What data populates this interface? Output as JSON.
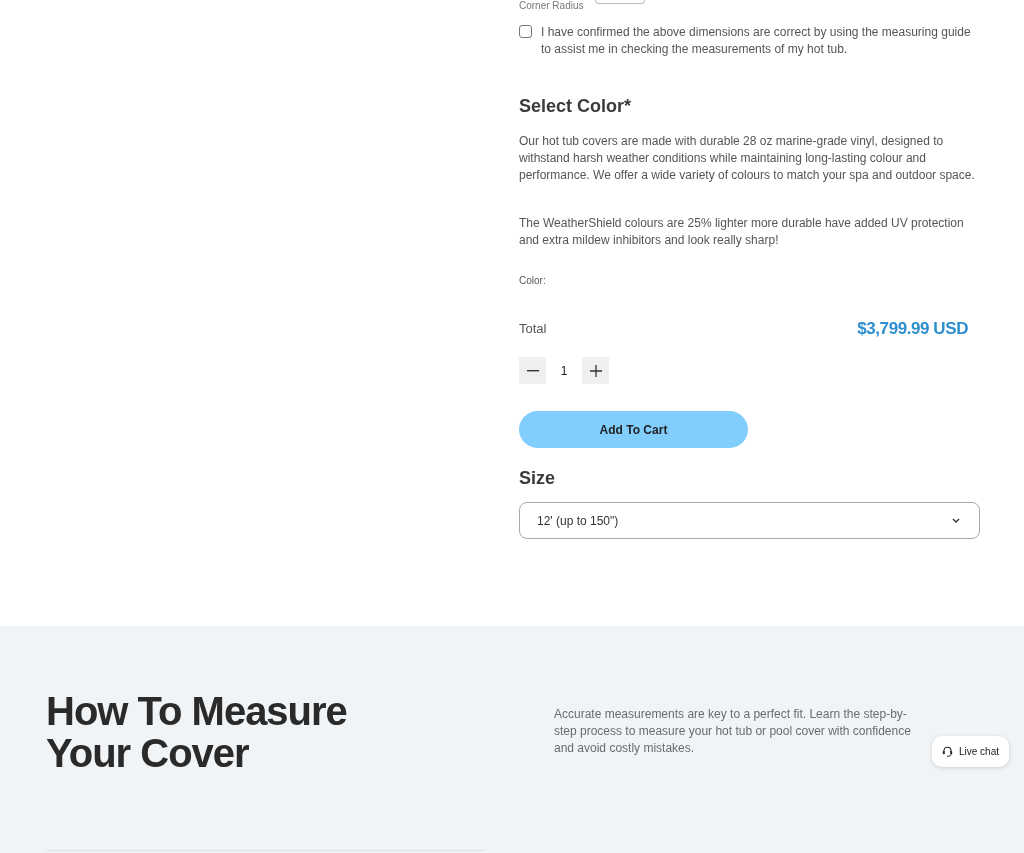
{
  "dimensions": {
    "corner_radius_label": "Corner Radius"
  },
  "confirmation": {
    "checked": false,
    "label": "I have confirmed the above dimensions are correct by using the measuring guide to assist me in checking the measurements of my hot tub."
  },
  "color_section": {
    "title": "Select Color*",
    "paragraphs": [
      "Our hot tub covers are made with durable 28 oz marine-grade vinyl, designed to withstand harsh weather conditions while maintaining long-lasting colour and performance. We offer a wide variety of colours to match your spa and outdoor space.",
      "The WeatherShield colours are 25% lighter more durable have added UV protection and extra mildew inhibitors and look really sharp!"
    ],
    "color_label": "Color:"
  },
  "total": {
    "label": "Total",
    "price": "$3,799.99 USD"
  },
  "quantity": {
    "value": "1"
  },
  "add_to_cart": {
    "label": "Add To Cart"
  },
  "size": {
    "title": "Size",
    "value": "12' (up to 150\")"
  },
  "measure_section": {
    "title": "How To Measure Your Cover",
    "description": "Accurate measurements are key to a perfect fit. Learn the step-by-step process to measure your hot tub or pool cover with confidence and avoid costly mistakes."
  },
  "live_chat": {
    "label": "Live chat"
  }
}
